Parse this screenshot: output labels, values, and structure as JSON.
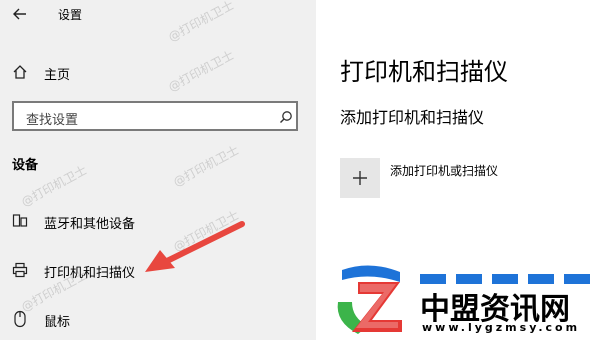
{
  "window": {
    "title": "设置",
    "back_label": "←"
  },
  "sidebar": {
    "home_label": "主页",
    "search_placeholder": "查找设置",
    "section_label": "设备",
    "items": [
      {
        "label": "蓝牙和其他设备",
        "icon": "bluetooth-devices-icon"
      },
      {
        "label": "打印机和扫描仪",
        "icon": "printer-icon"
      },
      {
        "label": "鼠标",
        "icon": "mouse-icon"
      }
    ]
  },
  "main": {
    "title": "打印机和扫描仪",
    "subtitle": "添加打印机和扫描仪",
    "add_label": "添加打印机或扫描仪"
  },
  "watermark": {
    "text": "@打印机卫士"
  },
  "brand": {
    "name": "中盟资讯网",
    "url": "www.lygzmsy.com"
  },
  "colors": {
    "arrow": "#e8473f",
    "logo_blue": "#1e73d8",
    "logo_green": "#3cb44a",
    "logo_red": "#e53935"
  }
}
